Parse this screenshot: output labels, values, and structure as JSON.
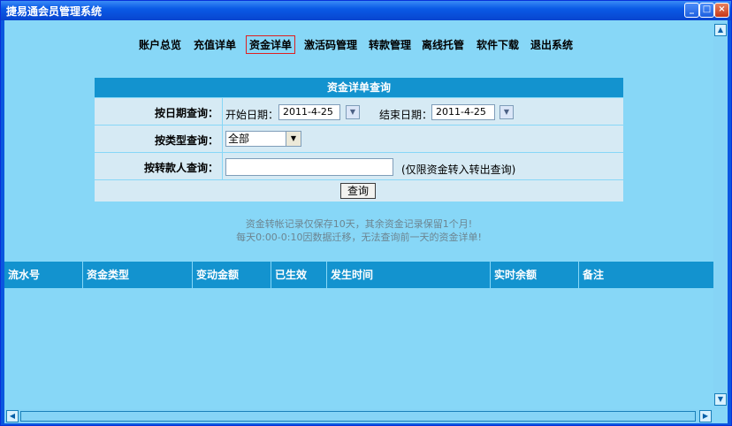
{
  "window": {
    "title": "捷易通会员管理系统"
  },
  "nav": {
    "items": [
      {
        "label": "账户总览"
      },
      {
        "label": "充值详单"
      },
      {
        "label": "资金详单",
        "active": true
      },
      {
        "label": "激活码管理"
      },
      {
        "label": "转款管理"
      },
      {
        "label": "离线托管"
      },
      {
        "label": "软件下载"
      },
      {
        "label": "退出系统"
      }
    ]
  },
  "query_form": {
    "title": "资金详单查询",
    "date_label": "按日期查询：",
    "start_label": "开始日期：",
    "start_value": "2011-4-25",
    "end_label": "结束日期：",
    "end_value": "2011-4-25",
    "type_label": "按类型查询：",
    "type_selected": "全部",
    "transfer_label": "按转款人查询：",
    "transfer_value": "",
    "transfer_hint": "(仅限资金转入转出查询)",
    "submit_label": "查询"
  },
  "notice": {
    "line1": "资金转帐记录仅保存10天，其余资金记录保留1个月!",
    "line2": "每天0:00-0:10因数据迁移，无法查询前一天的资金详单!"
  },
  "table": {
    "columns": [
      "流水号",
      "资金类型",
      "变动金额",
      "已生效",
      "发生时间",
      "实时余额",
      "备注"
    ],
    "rows": []
  },
  "colors": {
    "background": "#87d7f7",
    "header": "#1393cf",
    "active_border": "#e02020"
  }
}
